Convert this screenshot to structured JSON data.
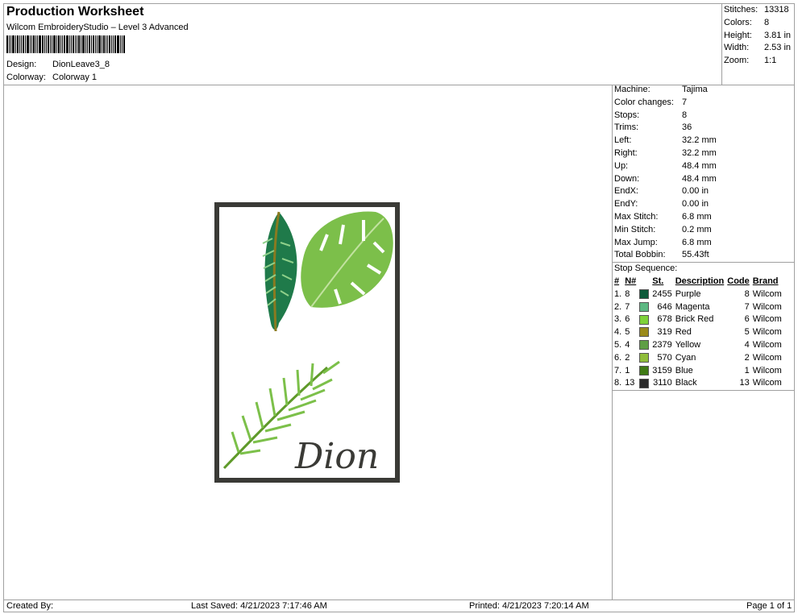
{
  "header": {
    "title": "Production Worksheet",
    "subtitle": "Wilcom EmbroideryStudio – Level 3 Advanced",
    "design_label": "Design:",
    "design_value": "DionLeave3_8",
    "colorway_label": "Colorway:",
    "colorway_value": "Colorway 1"
  },
  "summary": [
    {
      "k": "Stitches:",
      "v": "13318"
    },
    {
      "k": "Colors:",
      "v": "8"
    },
    {
      "k": "Height:",
      "v": "3.81 in"
    },
    {
      "k": "Width:",
      "v": "2.53 in"
    },
    {
      "k": "Zoom:",
      "v": "1:1"
    }
  ],
  "details": [
    {
      "k": "Machine:",
      "v": "Tajima"
    },
    {
      "k": "Color changes:",
      "v": "7"
    },
    {
      "k": "Stops:",
      "v": "8"
    },
    {
      "k": "Trims:",
      "v": "36"
    },
    {
      "k": "Left:",
      "v": "32.2 mm"
    },
    {
      "k": "Right:",
      "v": "32.2 mm"
    },
    {
      "k": "Up:",
      "v": "48.4 mm"
    },
    {
      "k": "Down:",
      "v": "48.4 mm"
    },
    {
      "k": "EndX:",
      "v": "0.00 in"
    },
    {
      "k": "EndY:",
      "v": "0.00 in"
    },
    {
      "k": "Max Stitch:",
      "v": "6.8 mm"
    },
    {
      "k": "Min Stitch:",
      "v": "0.2 mm"
    },
    {
      "k": "Max Jump:",
      "v": "6.8 mm"
    },
    {
      "k": "Total Bobbin:",
      "v": "55.43ft"
    }
  ],
  "stop_sequence": {
    "title": "Stop Sequence:",
    "headers": [
      "#",
      "N#",
      "St.",
      "Description",
      "Code",
      "Brand"
    ],
    "rows": [
      {
        "idx": "1.",
        "n": "8",
        "color": "#0d5a3a",
        "st": "2455",
        "desc": "Purple",
        "code": "8",
        "brand": "Wilcom"
      },
      {
        "idx": "2.",
        "n": "7",
        "color": "#5cb882",
        "st": "646",
        "desc": "Magenta",
        "code": "7",
        "brand": "Wilcom"
      },
      {
        "idx": "3.",
        "n": "6",
        "color": "#7fd23a",
        "st": "678",
        "desc": "Brick Red",
        "code": "6",
        "brand": "Wilcom"
      },
      {
        "idx": "4.",
        "n": "5",
        "color": "#9a8a1a",
        "st": "319",
        "desc": "Red",
        "code": "5",
        "brand": "Wilcom"
      },
      {
        "idx": "5.",
        "n": "4",
        "color": "#5e9e45",
        "st": "2379",
        "desc": "Yellow",
        "code": "4",
        "brand": "Wilcom"
      },
      {
        "idx": "6.",
        "n": "2",
        "color": "#8fbd3a",
        "st": "570",
        "desc": "Cyan",
        "code": "2",
        "brand": "Wilcom"
      },
      {
        "idx": "7.",
        "n": "1",
        "color": "#3f7a14",
        "st": "3159",
        "desc": "Blue",
        "code": "1",
        "brand": "Wilcom"
      },
      {
        "idx": "8.",
        "n": "13",
        "color": "#2a2a2a",
        "st": "3110",
        "desc": "Black",
        "code": "13",
        "brand": "Wilcom"
      }
    ]
  },
  "design_text": "Dion",
  "footer": {
    "created_by": "Created By:",
    "last_saved": "Last Saved: 4/21/2023 7:17:46 AM",
    "printed": "Printed: 4/21/2023 7:20:14 AM",
    "page": "Page 1 of 1"
  }
}
